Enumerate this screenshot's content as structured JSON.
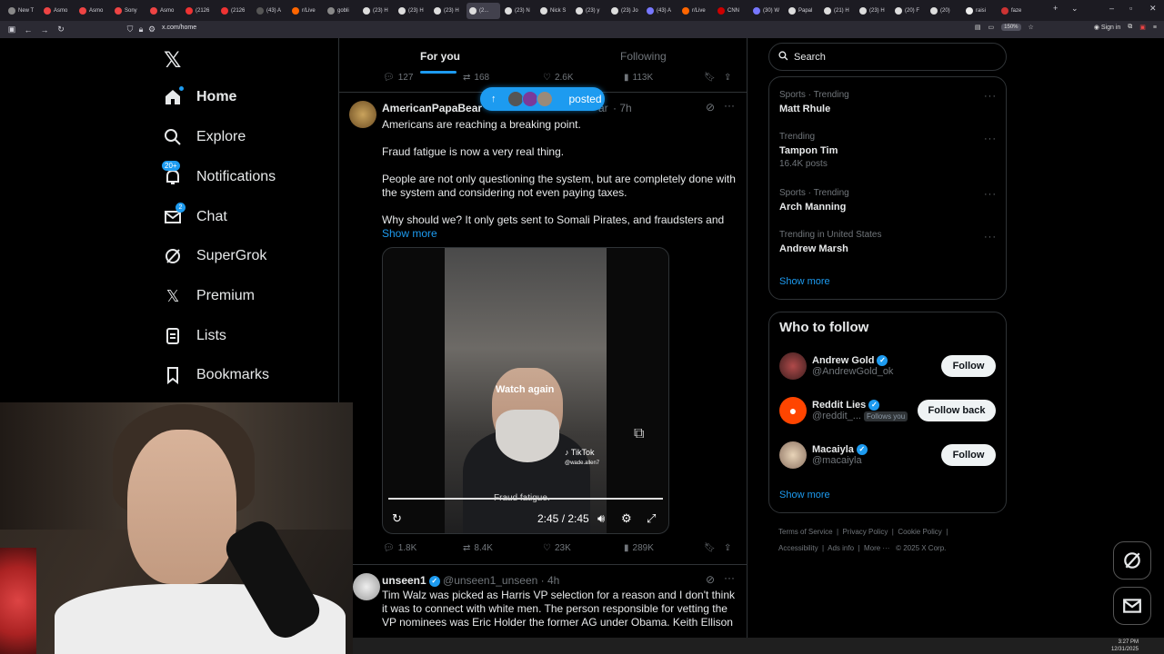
{
  "browser": {
    "tabs": [
      "New T",
      "Asmo",
      "Asmo",
      "Sony",
      "Asmo",
      "(2126",
      "(2126",
      "(43) A",
      "r/Live",
      "gobli",
      "(23) H",
      "(23) H",
      "(23) H",
      "(2...",
      "(23) N",
      "Nick S",
      "(23) y",
      "(23) Jo",
      "(43) A",
      "r/Live",
      "CNN",
      "(30) W",
      "Papal",
      "(21) H",
      "(23) H",
      "(20) F",
      "(20)",
      "raisi",
      "faze"
    ],
    "url": "x.com/home",
    "zoom": "150%",
    "signin": "Sign in"
  },
  "nav": {
    "items": [
      {
        "label": "Home",
        "icon": "home-icon"
      },
      {
        "label": "Explore",
        "icon": "search-icon"
      },
      {
        "label": "Notifications",
        "icon": "bell-icon",
        "badge": "20+"
      },
      {
        "label": "Chat",
        "icon": "mail-icon",
        "badge": "2"
      },
      {
        "label": "SuperGrok",
        "icon": "grok-icon"
      },
      {
        "label": "Premium",
        "icon": "x-icon"
      },
      {
        "label": "Lists",
        "icon": "list-icon"
      },
      {
        "label": "Bookmarks",
        "icon": "bookmark-icon"
      }
    ]
  },
  "timeline": {
    "tabs": [
      "For you",
      "Following"
    ],
    "prev_stats": {
      "replies": "127",
      "reposts": "168",
      "likes": "2.6K",
      "views": "113K"
    },
    "posted_pill": "posted",
    "tweet1": {
      "name": "AmericanPapaBear",
      "handle_tail": "ar",
      "time": "· 7h",
      "lines": [
        "Americans are reaching a breaking point.",
        "Fraud fatigue is now a very real thing.",
        "People are not only questioning the system, but are completely done with the system and considering not even paying taxes.",
        "Why should we? It only gets sent to Somali Pirates, and fraudsters and"
      ],
      "show_more": "Show more",
      "video": {
        "watch_again": "Watch again",
        "tiktok": "TikTok",
        "tiktok_handle": "@wade.allen7",
        "caption": "Fraud fatigue.",
        "time": "2:45 / 2:45"
      },
      "stats": {
        "replies": "1.8K",
        "reposts": "8.4K",
        "likes": "23K",
        "views": "289K"
      }
    },
    "tweet2": {
      "name": "unseen1",
      "handle": "@unseen1_unseen",
      "time": "· 4h",
      "text": "Tim Walz was picked as Harris VP selection for a reason and I don't think it was to connect with white men.   The person responsible for vetting the VP nominees was Eric Holder  the former AG under Obama. Keith Ellison"
    }
  },
  "right": {
    "search_placeholder": "Search",
    "trends": [
      {
        "category": "Sports · Trending",
        "name": "Matt Rhule",
        "count": ""
      },
      {
        "category": "Trending",
        "name": "Tampon Tim",
        "count": "16.4K posts"
      },
      {
        "category": "Sports · Trending",
        "name": "Arch Manning",
        "count": ""
      },
      {
        "category": "Trending in United States",
        "name": "Andrew Marsh",
        "count": ""
      }
    ],
    "trends_show_more": "Show more",
    "who_to_follow": "Who to follow",
    "follows": [
      {
        "name": "Andrew Gold",
        "handle": "@AndrewGold_ok",
        "button": "Follow",
        "follows_you": ""
      },
      {
        "name": "Reddit Lies",
        "handle": "@reddit_...",
        "button": "Follow back",
        "follows_you": "Follows you"
      },
      {
        "name": "Macaiyla",
        "handle": "@macaiyla",
        "button": "Follow",
        "follows_you": ""
      }
    ],
    "follow_show_more": "Show more",
    "footer": {
      "line1": [
        "Terms of Service",
        "Privacy Policy",
        "Cookie Policy"
      ],
      "line2": [
        "Accessibility",
        "Ads info",
        "More ···",
        "© 2025 X Corp."
      ]
    }
  },
  "taskbar": {
    "time": "3:27 PM",
    "date": "12/31/2025"
  }
}
